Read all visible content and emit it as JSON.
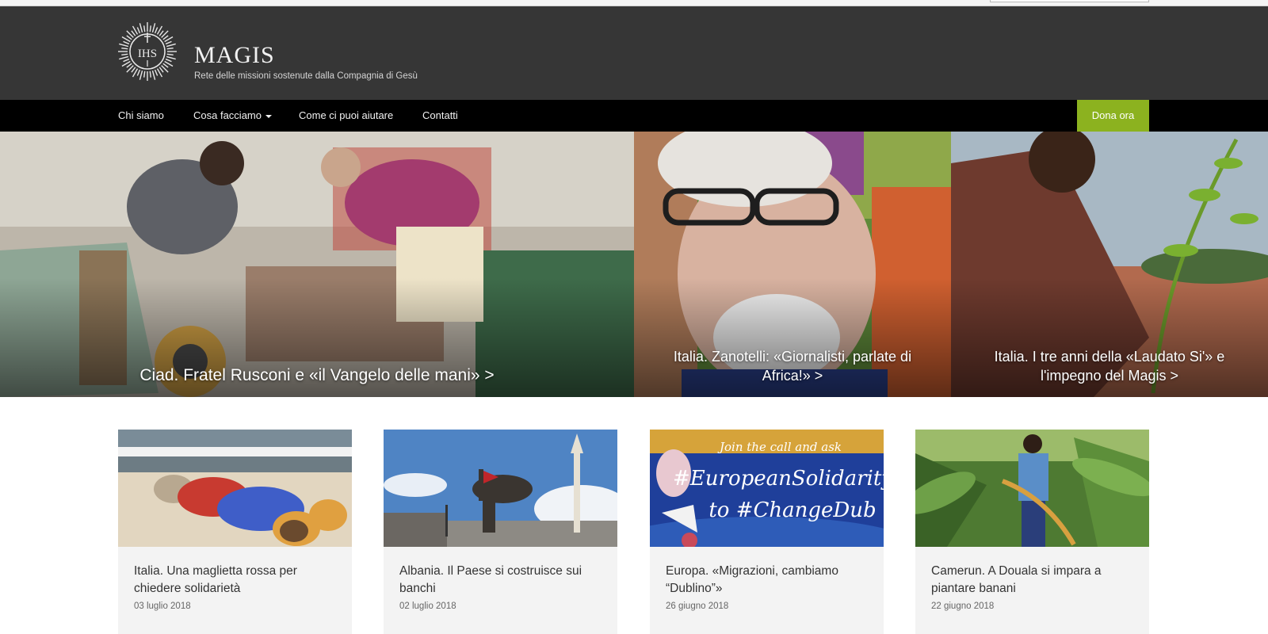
{
  "site": {
    "title": "MAGIS",
    "tagline": "Rete delle missioni sostenute dalla Compagnia di Gesù",
    "logo_text": "IHS"
  },
  "nav": {
    "items": [
      {
        "label": "Chi siamo"
      },
      {
        "label": "Cosa facciamo",
        "dropdown": true
      },
      {
        "label": "Come ci puoi aiutare"
      },
      {
        "label": "Contatti"
      }
    ],
    "donate_label": "Dona ora"
  },
  "colors": {
    "header_bg": "#363636",
    "nav_bg": "#000000",
    "donate_green": "#8cb21f",
    "card_bg": "#f3f3f3"
  },
  "hero": [
    {
      "caption": "Ciad. Fratel Rusconi e «il Vangelo delle mani» >"
    },
    {
      "caption": "Italia. Zanotelli: «Giornalisti, parlate di Africa!» >"
    },
    {
      "caption": "Italia. I tre anni della «Laudato Si'» e l'impegno del Magis >"
    }
  ],
  "articles": [
    {
      "title": "Italia. Una maglietta rossa per chiedere solidarietà",
      "date": "03 luglio 2018"
    },
    {
      "title": "Albania. Il Paese si costruisce sui banchi",
      "date": "02 luglio 2018"
    },
    {
      "title": "Europa. «Migrazioni, cambiamo “Dublino”»",
      "date": "26 giugno 2018",
      "image_text": [
        "Join the call and ask",
        "#EuropeanSolidarity",
        "to #ChangeDub"
      ]
    },
    {
      "title": "Camerun. A Douala si impara a piantare banani",
      "date": "22 giugno 2018"
    }
  ]
}
